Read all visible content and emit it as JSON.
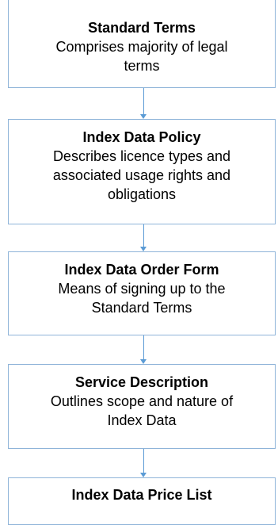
{
  "flow": {
    "steps": [
      {
        "title": "Standard Terms",
        "desc_lines": [
          "Comprises majority of legal",
          "terms"
        ]
      },
      {
        "title": "Index Data Policy",
        "desc_lines": [
          "Describes licence types and",
          "associated usage rights and",
          "obligations"
        ]
      },
      {
        "title": "Index Data Order Form",
        "desc_lines": [
          "Means of signing up to the",
          "Standard Terms"
        ]
      },
      {
        "title": "Service Description",
        "desc_lines": [
          "Outlines scope and nature of",
          "Index Data"
        ]
      },
      {
        "title": "Index Data Price List",
        "desc_lines": []
      }
    ]
  },
  "colors": {
    "box_border": "#8fb4d9",
    "arrow": "#5b9bd5"
  }
}
